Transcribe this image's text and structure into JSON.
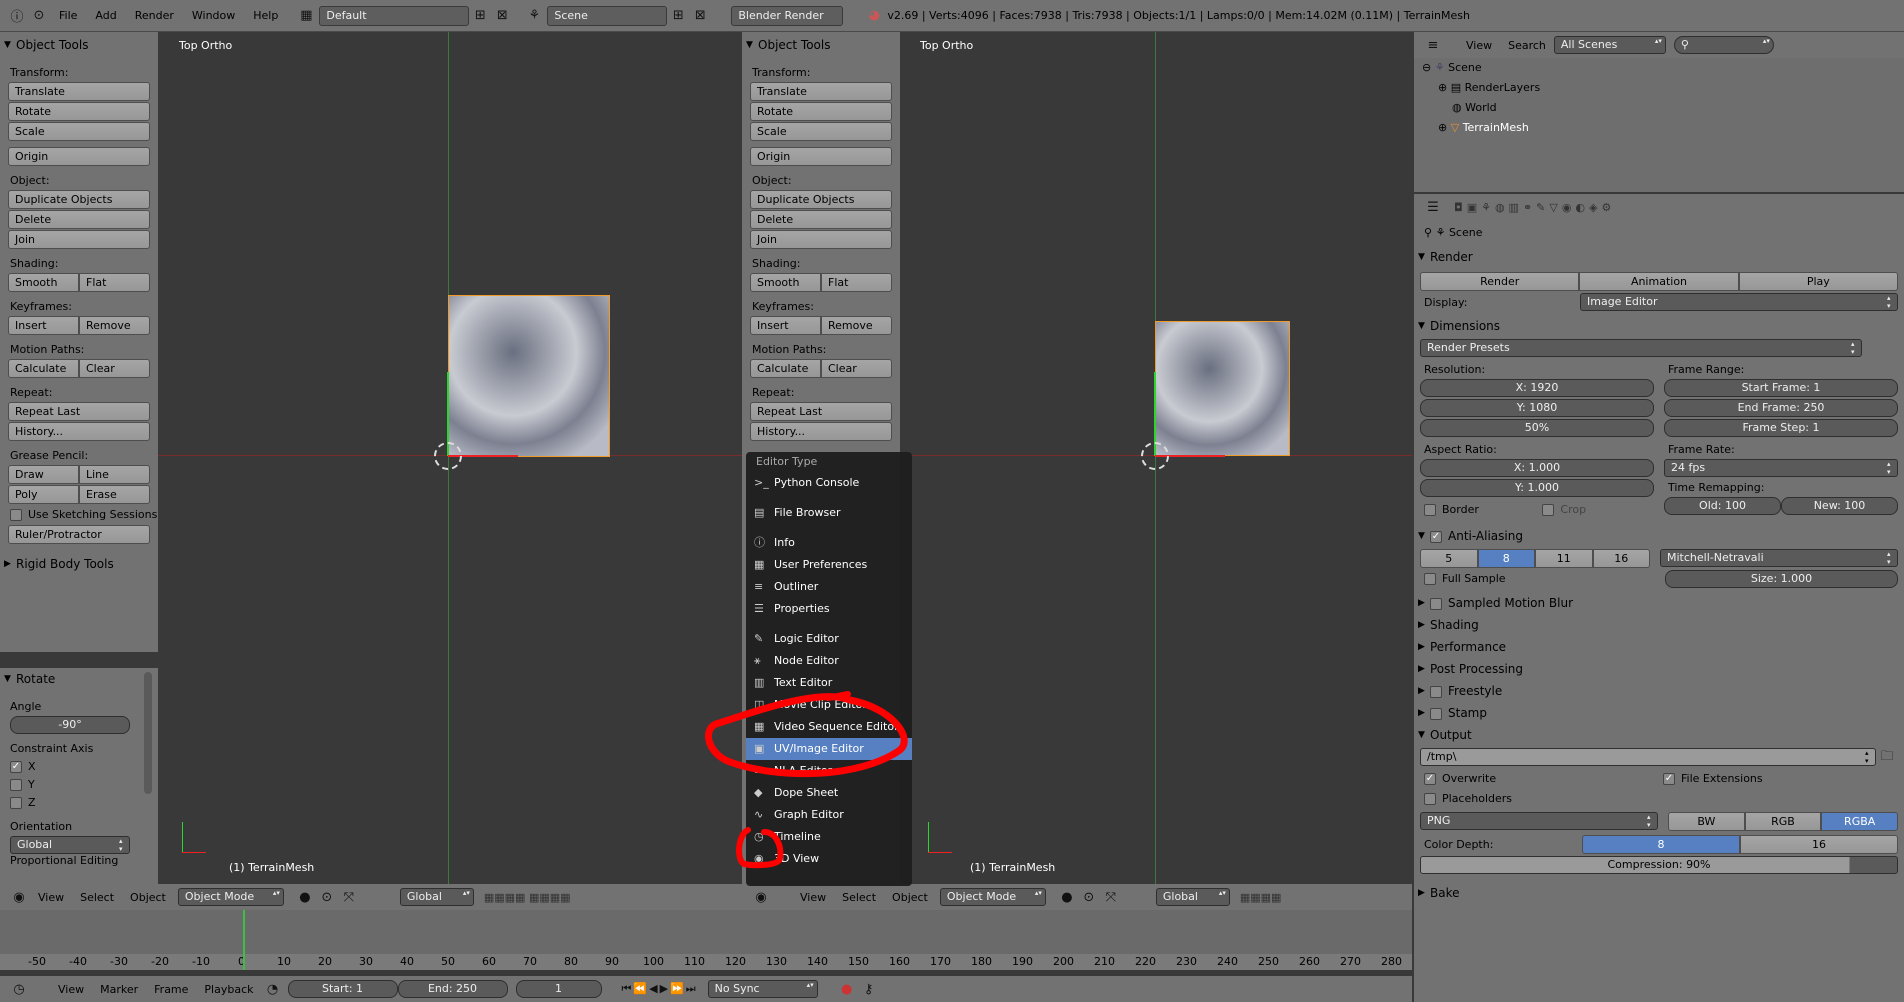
{
  "topbar": {
    "menus": [
      "File",
      "Add",
      "Render",
      "Window",
      "Help"
    ],
    "layout": "Default",
    "scene": "Scene",
    "engine": "Blender Render",
    "status": "v2.69 | Verts:4096 | Faces:7938 | Tris:7938 | Objects:1/1 | Lamps:0/0 | Mem:14.02M (0.11M) | TerrainMesh"
  },
  "tools": {
    "title": "Object Tools",
    "transform": "Transform:",
    "translate": "Translate",
    "rotate": "Rotate",
    "scale": "Scale",
    "origin": "Origin",
    "object": "Object:",
    "duplicate": "Duplicate Objects",
    "delete": "Delete",
    "join": "Join",
    "shading": "Shading:",
    "smooth": "Smooth",
    "flat": "Flat",
    "keyframes": "Keyframes:",
    "insert": "Insert",
    "remove": "Remove",
    "motion": "Motion Paths:",
    "calculate": "Calculate",
    "clear": "Clear",
    "repeat": "Repeat:",
    "repeat_last": "Repeat Last",
    "history": "History...",
    "grease": "Grease Pencil:",
    "draw": "Draw",
    "line": "Line",
    "poly": "Poly",
    "erase": "Erase",
    "sketch": "Use Sketching Sessions",
    "ruler": "Ruler/Protractor",
    "rigid": "Rigid Body Tools"
  },
  "operator": {
    "title": "Rotate",
    "angle_label": "Angle",
    "angle": "-90°",
    "constraint": "Constraint Axis",
    "x": "X",
    "y": "Y",
    "z": "Z",
    "orientation_label": "Orientation",
    "orientation": "Global",
    "prop": "Proportional Editing"
  },
  "viewport": {
    "label": "Top Ortho",
    "object": "(1) TerrainMesh"
  },
  "header3d": {
    "view": "View",
    "select": "Select",
    "object": "Object",
    "mode": "Object Mode",
    "orient": "Global"
  },
  "timeline": {
    "ticks": [
      "-50",
      "-40",
      "-30",
      "-20",
      "-10",
      "0",
      "10",
      "20",
      "30",
      "40",
      "50",
      "60",
      "70",
      "80",
      "90",
      "100",
      "110",
      "120",
      "130",
      "140",
      "150",
      "160",
      "170",
      "180",
      "190",
      "200",
      "210",
      "220",
      "230",
      "240",
      "250",
      "260",
      "270",
      "280"
    ],
    "view": "View",
    "marker": "Marker",
    "frame": "Frame",
    "playback": "Playback",
    "start": "Start: 1",
    "end": "End: 250",
    "current": "1",
    "sync": "No Sync"
  },
  "editor_menu": {
    "title": "Editor Type",
    "items": [
      {
        "label": "Python Console",
        "icon": ">_"
      },
      {
        "label": "File Browser",
        "icon": "▤"
      },
      {
        "label": "Info",
        "icon": "ⓘ"
      },
      {
        "label": "User Preferences",
        "icon": "▦"
      },
      {
        "label": "Outliner",
        "icon": "≡"
      },
      {
        "label": "Properties",
        "icon": "☰"
      },
      {
        "label": "Logic Editor",
        "icon": "✎"
      },
      {
        "label": "Node Editor",
        "icon": "⚹"
      },
      {
        "label": "Text Editor",
        "icon": "▥"
      },
      {
        "label": "Movie Clip Editor",
        "icon": "◫"
      },
      {
        "label": "Video Sequence Editor",
        "icon": "▦"
      },
      {
        "label": "UV/Image Editor",
        "icon": "▣"
      },
      {
        "label": "NLA Editor",
        "icon": "≡"
      },
      {
        "label": "Dope Sheet",
        "icon": "◆"
      },
      {
        "label": "Graph Editor",
        "icon": "∿"
      },
      {
        "label": "Timeline",
        "icon": "◷"
      },
      {
        "label": "3D View",
        "icon": "◉"
      }
    ]
  },
  "outliner": {
    "view": "View",
    "search": "Search",
    "filter": "All Scenes",
    "scene": "Scene",
    "renderlayers": "RenderLayers",
    "world": "World",
    "mesh": "TerrainMesh"
  },
  "properties": {
    "scene": "Scene",
    "render_h": "Render",
    "render": "Render",
    "animation": "Animation",
    "play": "Play",
    "display_label": "Display:",
    "display": "Image Editor",
    "dimensions": "Dimensions",
    "presets": "Render Presets",
    "resolution": "Resolution:",
    "resx": "X: 1920",
    "resy": "Y: 1080",
    "respct": "50%",
    "frame_range": "Frame Range:",
    "start_frame": "Start Frame: 1",
    "end_frame": "End Frame: 250",
    "frame_step": "Frame Step: 1",
    "aspect": "Aspect Ratio:",
    "ax": "X: 1.000",
    "ay": "Y: 1.000",
    "frame_rate": "Frame Rate:",
    "fps": "24 fps",
    "time_remap": "Time Remapping:",
    "old": "Old: 100",
    "new": "New: 100",
    "border": "Border",
    "crop": "Crop",
    "aa": "Anti-Aliasing",
    "aa_vals": [
      "5",
      "8",
      "11",
      "16"
    ],
    "filter": "Mitchell-Netravali",
    "full_sample": "Full Sample",
    "size": "Size: 1.000",
    "motion_blur": "Sampled Motion Blur",
    "shading": "Shading",
    "performance": "Performance",
    "post": "Post Processing",
    "freestyle": "Freestyle",
    "stamp": "Stamp",
    "output": "Output",
    "path": "/tmp\\",
    "overwrite": "Overwrite",
    "file_ext": "File Extensions",
    "placeholders": "Placeholders",
    "format": "PNG",
    "bw": "BW",
    "rgb": "RGB",
    "rgba": "RGBA",
    "depth_label": "Color Depth:",
    "d8": "8",
    "d16": "16",
    "compression": "Compression: 90%",
    "bake": "Bake"
  },
  "colors": {
    "accent": "#5680c2",
    "annotation": "#ff0000"
  }
}
